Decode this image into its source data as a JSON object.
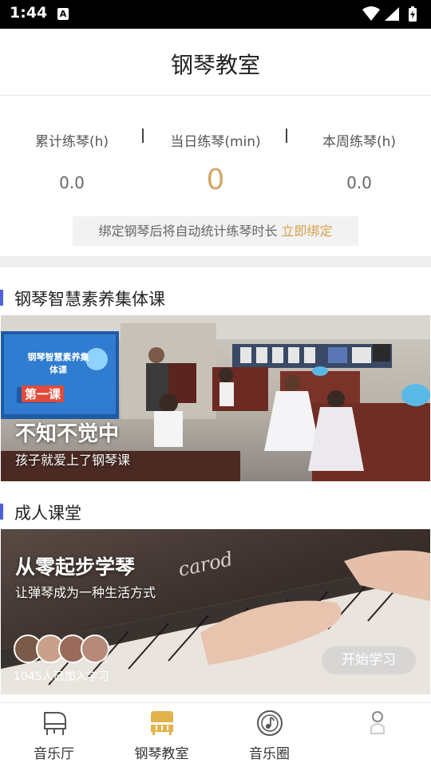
{
  "status_bar": {
    "time": "1:44",
    "notification_letter": "A"
  },
  "header": {
    "title": "钢琴教室"
  },
  "stats": [
    {
      "label": "累计练琴(h)",
      "value": "0.0"
    },
    {
      "label": "当日练琴(min)",
      "value": "0"
    },
    {
      "label": "本周练琴(h)",
      "value": "0.0"
    }
  ],
  "bind_notice": {
    "text": "绑定钢琴后将自动统计练琴时长",
    "link": "立即绑定"
  },
  "sections": {
    "group_course": {
      "title": "钢琴智慧素养集体课",
      "headline": "不知不觉中",
      "sub": "孩子就爱上了钢琴课",
      "screen_title": "钢琴智慧素养集体课",
      "screen_lesson": "第一课"
    },
    "adult_course": {
      "title": "成人课堂",
      "headline": "从零起步学琴",
      "sub": "让弹琴成为一种生活方式",
      "brand": "carod",
      "join_count": "1045人已加入学习",
      "start_button": "开始学习"
    }
  },
  "tabbar": {
    "items": [
      {
        "label": "音乐厅",
        "icon": "grand-piano-icon"
      },
      {
        "label": "钢琴教室",
        "icon": "upright-piano-icon"
      },
      {
        "label": "音乐圈",
        "icon": "music-note-circle-icon"
      },
      {
        "label": "",
        "icon": "profile-icon"
      }
    ]
  },
  "colors": {
    "accent_gold": "#d4a868",
    "link_gold": "#d4a24c",
    "section_bar": "#4a63d6"
  }
}
